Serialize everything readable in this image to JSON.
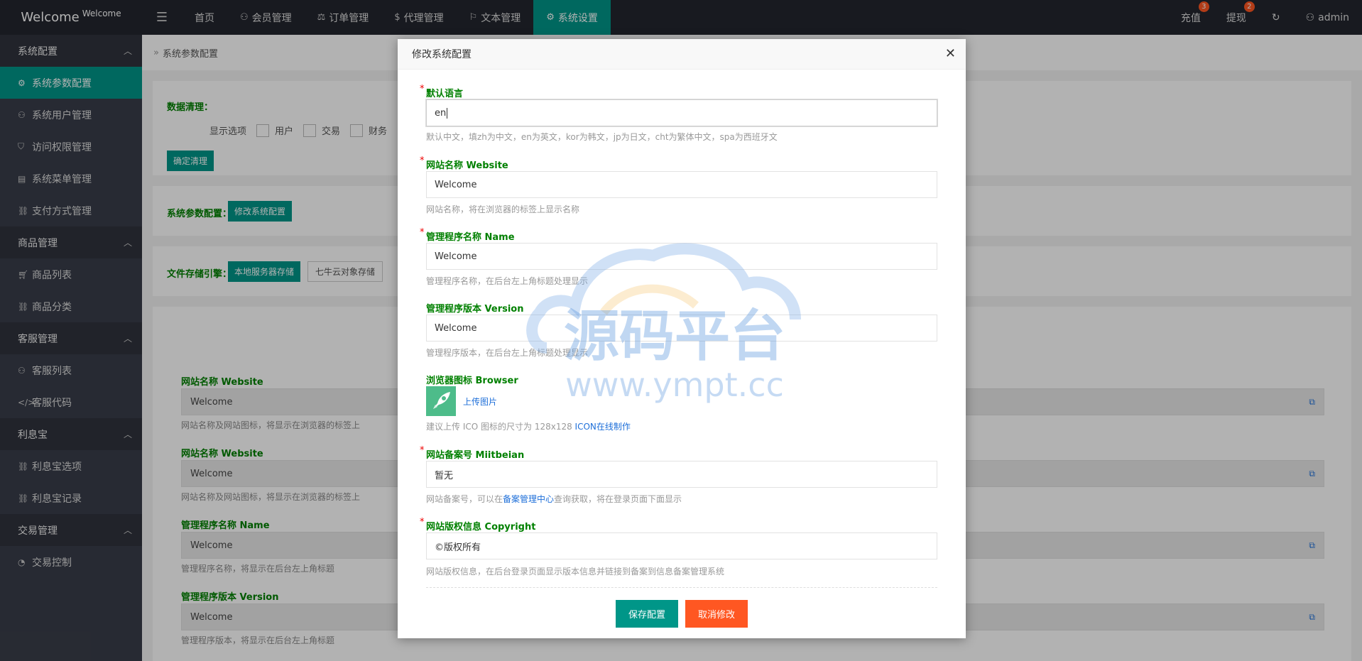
{
  "header": {
    "logo_main": "Welcome",
    "logo_sub": "Welcome",
    "menu_icon": "menu-icon",
    "nav": [
      {
        "label": "首页",
        "icon": ""
      },
      {
        "label": "会员管理",
        "icon": "user-icon"
      },
      {
        "label": "订单管理",
        "icon": "scale-icon"
      },
      {
        "label": "代理管理",
        "icon": "dollar-icon"
      },
      {
        "label": "文本管理",
        "icon": "flag-icon"
      },
      {
        "label": "系统设置",
        "icon": "gear-icon",
        "active": true
      }
    ],
    "right": {
      "recharge": "充值",
      "recharge_badge": "3",
      "withdraw": "提现",
      "withdraw_badge": "2",
      "user": "admin"
    }
  },
  "sidebar": {
    "groups": [
      {
        "label": "系统配置",
        "items": [
          "系统参数配置",
          "系统用户管理",
          "访问权限管理",
          "系统菜单管理",
          "支付方式管理"
        ]
      },
      {
        "label": "商品管理",
        "items": [
          "商品列表",
          "商品分类"
        ]
      },
      {
        "label": "客服管理",
        "items": [
          "客服列表",
          "客服代码"
        ]
      },
      {
        "label": "利息宝",
        "items": [
          "利息宝选项",
          "利息宝记录"
        ]
      },
      {
        "label": "交易管理",
        "items": [
          "交易控制"
        ]
      }
    ],
    "active": "系统参数配置"
  },
  "main": {
    "breadcrumb": "系统参数配置",
    "clean": {
      "label": "数据清理：",
      "display_label": "显示选项",
      "options": [
        "用户",
        "交易",
        "财务"
      ],
      "button": "确定清理"
    },
    "params": {
      "label": "系统参数配置：",
      "button": "修改系统配置"
    },
    "storage": {
      "label": "文件存储引擎：",
      "active": "本地服务器存储",
      "other": "七牛云对象存储"
    },
    "fields": [
      {
        "label": "网站名称 Website",
        "value": "Welcome",
        "hint": "网站名称及网站图标，将显示在浏览器的标签上"
      },
      {
        "label": "网站名称 Website",
        "value": "Welcome",
        "hint": "网站名称及网站图标，将显示在浏览器的标签上"
      },
      {
        "label": "管理程序名称 Name",
        "value": "Welcome",
        "hint": "管理程序名称，将显示在后台左上角标题"
      },
      {
        "label": "管理程序版本 Version",
        "value": "Welcome",
        "hint": "管理程序版本，将显示在后台左上角标题"
      }
    ]
  },
  "modal": {
    "title": "修改系统配置",
    "lang": {
      "label": "默认语言",
      "value": "en",
      "hint": "默认中文，填zh为中文，en为英文，kor为韩文，jp为日文，cht为繁体中文，spa为西班牙文"
    },
    "website": {
      "label": "网站名称 Website",
      "value": "Welcome",
      "hint": "网站名称，将在浏览器的标签上显示名称"
    },
    "app_name": {
      "label": "管理程序名称 Name",
      "value": "Welcome",
      "hint": "管理程序名称，在后台左上角标题处理显示"
    },
    "app_version": {
      "label": "管理程序版本 Version",
      "value": "Welcome",
      "hint": "管理程序版本，在后台左上角标题处理显示"
    },
    "browser_icon": {
      "label": "浏览器图标 Browser",
      "upload": "上传图片",
      "hint_prefix": "建议上传 ICO 图标的尺寸为 128x128 ",
      "hint_link": "ICON在线制作"
    },
    "miitbeian": {
      "label": "网站备案号 Miitbeian",
      "value": "暂无",
      "hint_prefix": "网站备案号，可以在",
      "hint_link": "备案管理中心",
      "hint_suffix": "查询获取，将在登录页面下面显示"
    },
    "copyright": {
      "label": "网站版权信息 Copyright",
      "value": "©版权所有",
      "hint": "网站版权信息，在后台登录页面显示版本信息并链接到备案到信息备案管理系统"
    },
    "save": "保存配置",
    "cancel": "取消修改"
  },
  "watermark": {
    "line1": "源码平台",
    "line2": "www.ympt.cc"
  }
}
